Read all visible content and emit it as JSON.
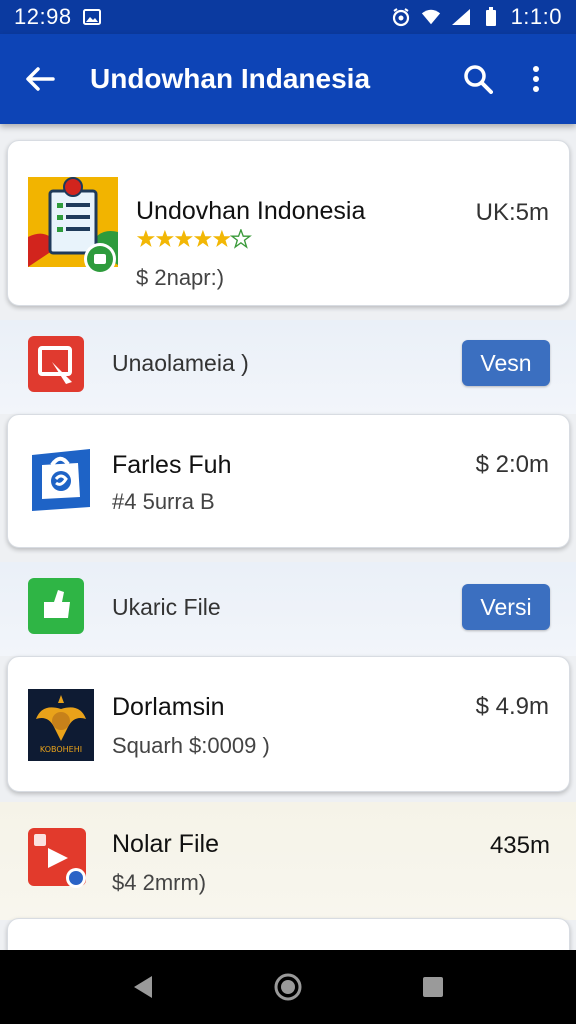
{
  "status_bar": {
    "time": "12:98",
    "clock_right": "1:1:0",
    "icons": [
      "image-icon",
      "alarm-icon",
      "wifi-icon",
      "signal-icon",
      "battery-icon"
    ]
  },
  "toolbar": {
    "title": "Undowhan Indanesia",
    "icons": [
      "back-arrow-icon",
      "search-icon",
      "more-vert-icon"
    ]
  },
  "items": [
    {
      "name": "Undovhan Indonesia",
      "rating_stars": 5,
      "subtitle": "$ 2napr:)",
      "meta": "UK:5m",
      "icon": "app-document-icon"
    },
    {
      "label": "Unaolameia )",
      "button": "Vesn",
      "icon": "app-red-square-icon"
    },
    {
      "name": "Farles Fuh",
      "subtitle": "#4 5urra B",
      "meta": "$ 2:0m",
      "icon": "app-blue-bag-icon"
    },
    {
      "label": "Ukaric File",
      "button": "Versi",
      "icon": "app-green-icon"
    },
    {
      "name": "Dorlamsin",
      "subtitle": "Squarh $:0009 )",
      "meta": "$ 4.9m",
      "icon": "app-emblem-icon",
      "icon_text": "KOBOHEHI"
    },
    {
      "name": "Nolar File",
      "subtitle": "$4 2mrm)",
      "meta": "435m",
      "icon": "app-play-icon"
    }
  ],
  "nav_bar": {
    "icons": [
      "nav-back-icon",
      "nav-home-icon",
      "nav-recents-icon"
    ]
  },
  "colors": {
    "status_bar": "#0b3aa0",
    "toolbar": "#0d44b6",
    "button": "#3b6fc0",
    "star": "#f2b705"
  }
}
